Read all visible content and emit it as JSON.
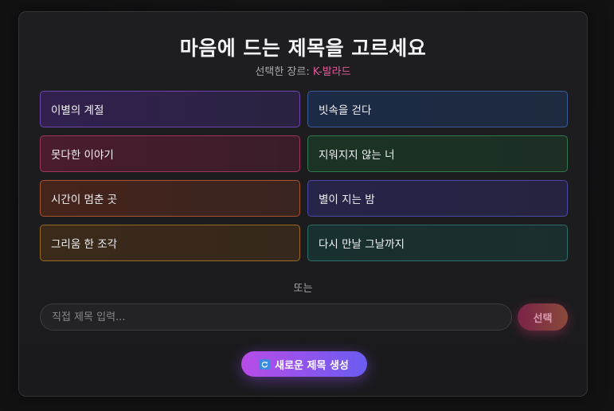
{
  "header": {
    "title": "마음에 드는 제목을 고르세요",
    "genre_prefix": "선택한 장르: ",
    "genre": "K-발라드"
  },
  "options": [
    {
      "label": "이별의 계절",
      "color": "#6a44b0"
    },
    {
      "label": "빗속을 걷다",
      "color": "#3b5c9c"
    },
    {
      "label": "못다한 이야기",
      "color": "#a0345c"
    },
    {
      "label": "지워지지 않는 너",
      "color": "#2f7a4a"
    },
    {
      "label": "시간이 멈춘 곳",
      "color": "#a8522e"
    },
    {
      "label": "별이 지는 밤",
      "color": "#4a47a8"
    },
    {
      "label": "그리움 한 조각",
      "color": "#9a6a22"
    },
    {
      "label": "다시 만날 그날까지",
      "color": "#2b6e6a"
    }
  ],
  "divider_text": "또는",
  "custom": {
    "placeholder": "직접 제목 입력...",
    "value": "",
    "submit_label": "선택"
  },
  "generate": {
    "icon": "refresh-icon",
    "label": "새로운 제목 생성"
  },
  "colors": {
    "accent_pink": "#e85a9e",
    "generate_start": "#b84ce8",
    "generate_end": "#6a5cf0"
  }
}
